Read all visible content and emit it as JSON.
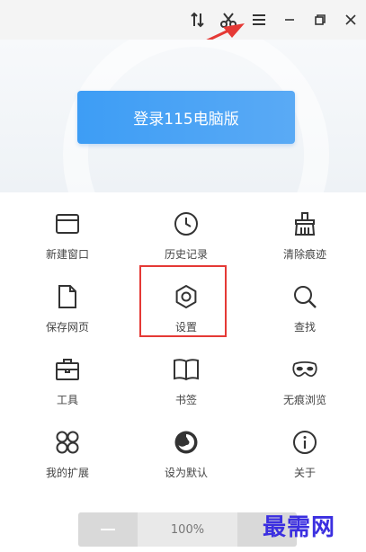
{
  "login": {
    "label": "登录115电脑版"
  },
  "menu": [
    {
      "label": "新建窗口",
      "icon": "new-window-icon"
    },
    {
      "label": "历史记录",
      "icon": "clock-icon"
    },
    {
      "label": "清除痕迹",
      "icon": "broom-icon"
    },
    {
      "label": "保存网页",
      "icon": "document-icon"
    },
    {
      "label": "设置",
      "icon": "gear-icon"
    },
    {
      "label": "查找",
      "icon": "search-icon"
    },
    {
      "label": "工具",
      "icon": "toolbox-icon"
    },
    {
      "label": "书签",
      "icon": "book-icon"
    },
    {
      "label": "无痕浏览",
      "icon": "mask-icon"
    },
    {
      "label": "我的扩展",
      "icon": "extensions-icon"
    },
    {
      "label": "设为默认",
      "icon": "default-browser-icon"
    },
    {
      "label": "关于",
      "icon": "info-icon"
    }
  ],
  "zoom": {
    "value": "100%"
  },
  "watermark": "最需网",
  "colors": {
    "login_button": "#4aa3f5",
    "highlight": "#e53935",
    "arrow": "#e53935",
    "watermark": "#3b2fe0"
  }
}
